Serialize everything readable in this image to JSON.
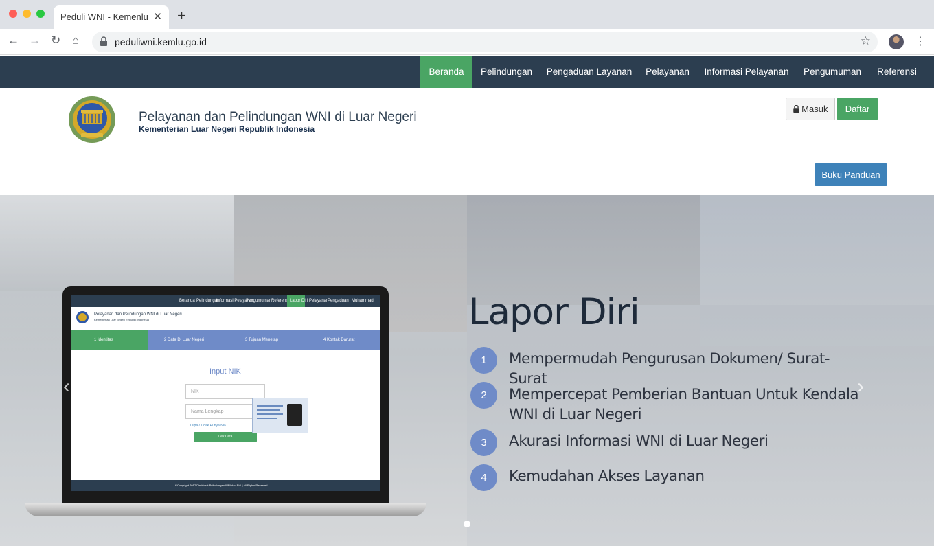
{
  "browser": {
    "tab_title": "Peduli WNI  - Kemenlu",
    "tab_close": "✕",
    "new_tab": "+",
    "url": "peduliwni.kemlu.go.id",
    "back": "←",
    "forward": "→",
    "reload": "↻",
    "home": "⌂",
    "star": "☆",
    "menu": "⋮"
  },
  "nav": {
    "items": [
      {
        "label": "Beranda"
      },
      {
        "label": "Pelindungan"
      },
      {
        "label": "Pengaduan Layanan"
      },
      {
        "label": "Pelayanan"
      },
      {
        "label": "Informasi Pelayanan"
      },
      {
        "label": "Pengumuman"
      },
      {
        "label": "Referensi"
      }
    ],
    "active_color": "#4aa564",
    "bg_color": "#2c3e50"
  },
  "header": {
    "title": "Pelayanan dan Pelindungan WNI di Luar Negeri",
    "subtitle": "Kementerian Luar Negeri Republik Indonesia",
    "login_label": "Masuk",
    "register_label": "Daftar",
    "guide_label": "Buku Panduan"
  },
  "hero": {
    "heading": "Lapor Diri",
    "features": [
      {
        "num": "1",
        "text": "Mempermudah Pengurusan Dokumen/ Surat-Surat"
      },
      {
        "num": "2",
        "text": "Mempercepat Pemberian Bantuan Untuk Kendala WNI di Luar Negeri"
      },
      {
        "num": "3",
        "text": "Akurasi  Informasi WNI di Luar Negeri"
      },
      {
        "num": "4",
        "text": "Kemudahan Akses Layanan"
      }
    ],
    "prev": "‹",
    "next": "›"
  },
  "laptop_screen": {
    "nav": [
      "Beranda",
      "Pelindungan",
      "Informasi Pelayanan",
      "Pengumuman",
      "Referensi",
      "Lapor Diri",
      "Pelayanan",
      "Pengaduan",
      "Muhammad"
    ],
    "title": "Pelayanan dan Pelindungan WNI di Luar Negeri",
    "subtitle": "Kementerian Luar Negeri Republik Indonesia",
    "steps": [
      "Identitas",
      "Data Di Luar Negeri",
      "Tujuan Menetap",
      "Kontak Darurat"
    ],
    "step_nums": [
      "1",
      "2",
      "3",
      "4"
    ],
    "form_title": "Input NIK",
    "nik_placeholder": "NIK",
    "name_placeholder": "Nama Lengkap",
    "forgot": "Lupa / Tidak Punya NIK",
    "check_button": "Cek Data",
    "footer": "©Copyright 2017 Direktorat Pelindungan WNI dan BHI | All Rights Reserved"
  }
}
